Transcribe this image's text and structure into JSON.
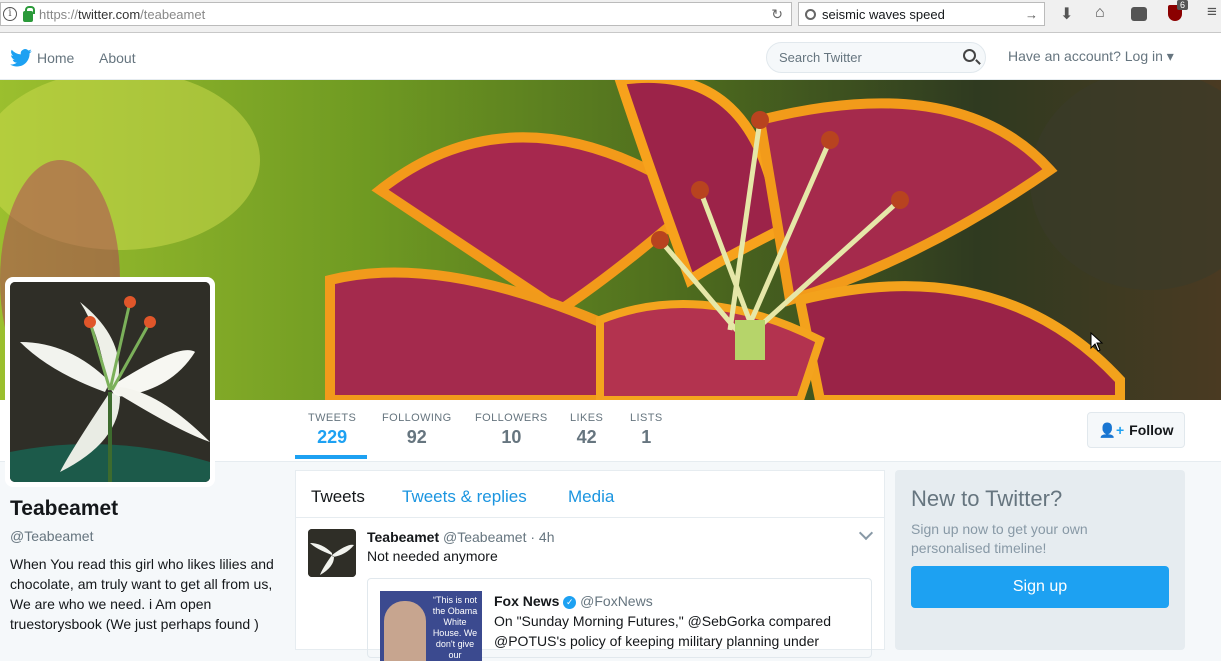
{
  "browser": {
    "url_scheme": "https://",
    "url_host": "twitter.com",
    "url_path": "/teabeamet",
    "search": "seismic waves speed",
    "badge": "6"
  },
  "nav": {
    "home": "Home",
    "about": "About",
    "search_placeholder": "Search Twitter",
    "login": "Have an account? Log in ▾"
  },
  "stats": [
    {
      "label": "TWEETS",
      "value": "229"
    },
    {
      "label": "FOLLOWING",
      "value": "92"
    },
    {
      "label": "FOLLOWERS",
      "value": "10"
    },
    {
      "label": "LIKES",
      "value": "42"
    },
    {
      "label": "LISTS",
      "value": "1"
    }
  ],
  "follow": "Follow",
  "profile": {
    "name": "Teabeamet",
    "handle": "@Teabeamet",
    "bio": "When You read this girl who likes lilies and chocolate, am truly want to get all from us, We are who we need. i Am open truestorysbook (We just perhaps found )"
  },
  "tabs": [
    "Tweets",
    "Tweets & replies",
    "Media"
  ],
  "tweet": {
    "name": "Teabeamet",
    "handle": "@Teabeamet",
    "time": "· 4h",
    "text": "Not needed anymore",
    "quote": {
      "name": "Fox News",
      "handle": "@FoxNews",
      "text": "On \"Sunday Morning Futures,\" @SebGorka compared @POTUS's policy of keeping military planning under",
      "image_text": "“This is not the Obama White House. We don't give our"
    }
  },
  "signup_box": {
    "title": "New to Twitter?",
    "text": "Sign up now to get your own personalised timeline!",
    "button": "Sign up"
  },
  "colors": {
    "accent": "#1da1f2"
  }
}
